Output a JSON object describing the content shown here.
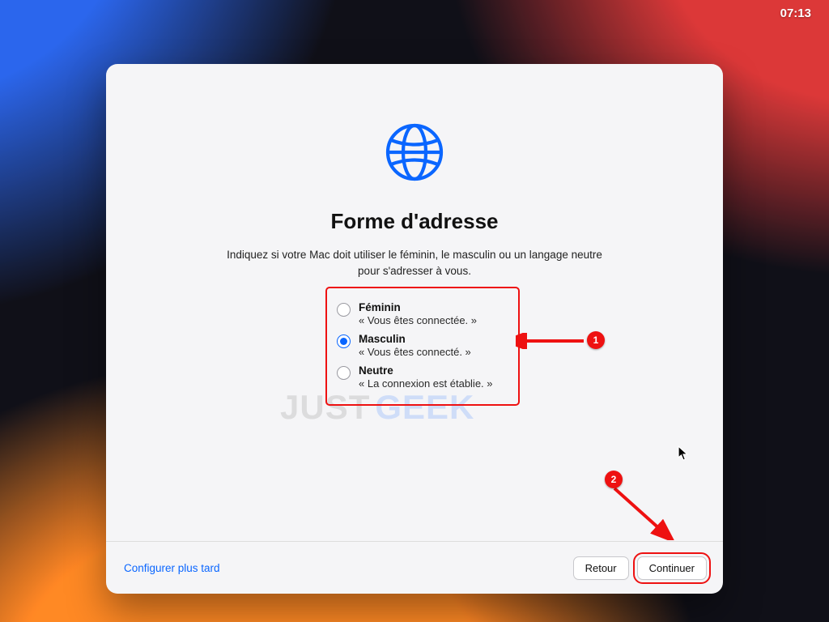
{
  "menubar": {
    "clock": "07:13"
  },
  "dialog": {
    "title": "Forme d'adresse",
    "subtitle": "Indiquez si votre Mac doit utiliser le féminin, le masculin ou un langage neutre pour s'adresser à vous.",
    "options": [
      {
        "label": "Féminin",
        "example": "« Vous êtes connectée. »",
        "selected": false
      },
      {
        "label": "Masculin",
        "example": "« Vous êtes connecté. »",
        "selected": true
      },
      {
        "label": "Neutre",
        "example": "« La connexion est établie. »",
        "selected": false
      }
    ],
    "footer": {
      "later": "Configurer plus tard",
      "back": "Retour",
      "continue": "Continuer"
    }
  },
  "annotations": {
    "callout1": "1",
    "callout2": "2"
  },
  "watermark": {
    "part1": "JUST",
    "part2": "GEEK"
  }
}
